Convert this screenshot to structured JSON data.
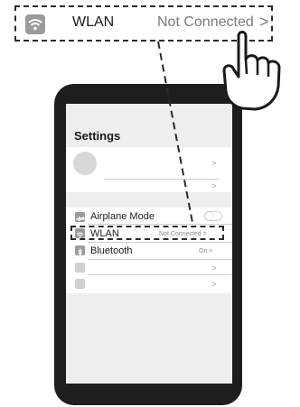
{
  "callout": {
    "icon": "wifi-icon",
    "label": "WLAN",
    "status": "Not Connected",
    "chevron": ">"
  },
  "settings": {
    "title": "Settings",
    "profile_chevron": ">",
    "blank_row_chevron": ">",
    "items": [
      {
        "icon": "airplane-icon",
        "label": "Airplane Mode",
        "value": "",
        "control": "toggle"
      },
      {
        "icon": "wifi-icon",
        "label": "WLAN",
        "value": "Not Connected >",
        "control": "chevron"
      },
      {
        "icon": "bluetooth-icon",
        "label": "Bluetooth",
        "value": "On >",
        "control": "chevron"
      },
      {
        "icon": "blank-icon",
        "label": "",
        "value": ">",
        "control": "chevron"
      },
      {
        "icon": "blank-icon",
        "label": "",
        "value": ">",
        "control": "chevron"
      }
    ]
  },
  "gesture": {
    "icon": "pointing-hand-icon"
  },
  "colors": {
    "phone_body": "#1e1e1e",
    "screen": "#eeeeee",
    "icon_gray": "#9b9b9b",
    "dash": "#2a2a2a"
  }
}
